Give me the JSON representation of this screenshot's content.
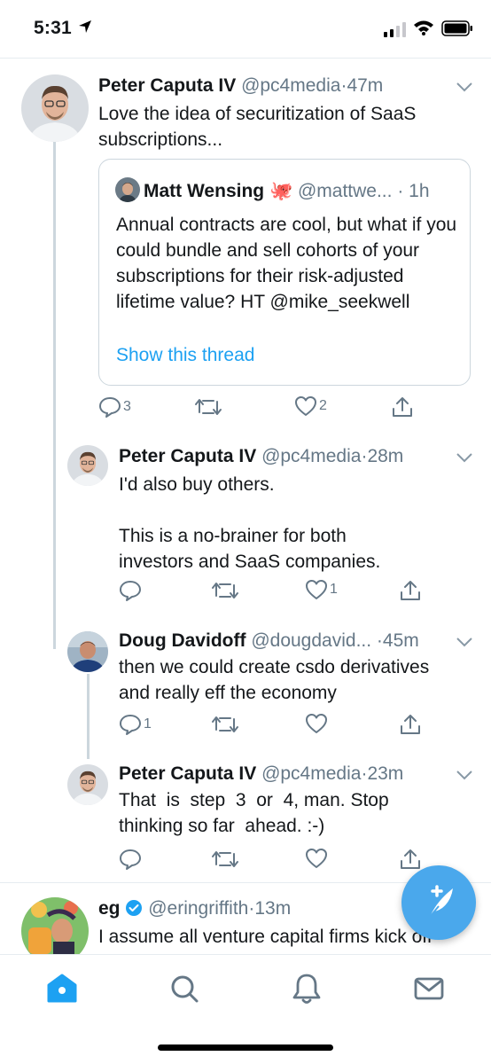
{
  "status_bar": {
    "time": "5:31"
  },
  "tweets": [
    {
      "name": "Peter Caputa IV",
      "handle": "@pc4media",
      "time": "47m",
      "text": "Love the idea of securitization of SaaS subscriptions...",
      "quote": {
        "name": "Matt Wensing",
        "emoji": "🐙",
        "handle": "@mattwe...",
        "time": "1h",
        "text": "Annual contracts are cool, but what if you could bundle and sell cohorts of your subscriptions for their risk-adjusted lifetime value?  HT @mike_seekwell",
        "link": "Show this thread"
      },
      "replies": "3",
      "retweets": "",
      "likes": "2"
    },
    {
      "name": "Peter Caputa IV",
      "handle": "@pc4media",
      "time": "28m",
      "text_lines": [
        "I'd also buy others.",
        "",
        "This is a no-brainer  for  both",
        "investors and SaaS companies."
      ],
      "replies": "",
      "retweets": "",
      "likes": "1"
    },
    {
      "name": "Doug Davidoff",
      "handle": "@dougdavid...",
      "time": "45m",
      "text_lines": [
        "then we could create csdo derivatives",
        "and really eff the economy"
      ],
      "replies": "1",
      "retweets": "",
      "likes": ""
    },
    {
      "name": "Peter Caputa IV",
      "handle": "@pc4media",
      "time": "23m",
      "text_lines": [
        "That  is  step  3  or  4, man. Stop",
        "thinking so far  ahead. :-)"
      ],
      "replies": "",
      "retweets": "",
      "likes": ""
    },
    {
      "name": "eg",
      "handle": "@eringriffith",
      "time": "13m",
      "verified": true,
      "text_lines": [
        "I assume all venture capital firms kick off"
      ]
    }
  ],
  "tabs": [
    "home",
    "search",
    "notifications",
    "messages"
  ],
  "icons": {
    "reply": "reply-icon",
    "retweet": "retweet-icon",
    "like": "like-icon",
    "share": "share-icon",
    "compose": "compose-tweet-icon"
  },
  "colors": {
    "accent": "#1da1f2",
    "muted": "#657786",
    "fab": "#4aa8ec",
    "home_active": "#1da1f2"
  }
}
